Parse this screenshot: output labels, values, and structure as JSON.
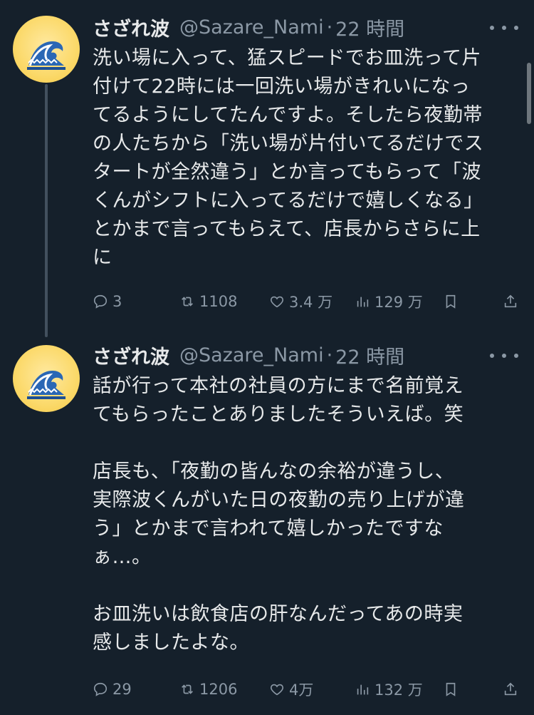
{
  "tweets": [
    {
      "author_name": "さざれ波",
      "handle": "@Sazare_Nami",
      "separator": "·",
      "time": "22 時間",
      "text": "洗い場に入って、猛スピードでお皿洗って片\n付けて22時には一回洗い場がきれいになっ\nてるようにしてたんですよ。そしたら夜勤帯\nの人たちから「洗い場が片付いてるだけでス\nタートが全然違う」とか言ってもらって「波\nくんがシフトに入ってるだけで嬉しくなる」\nとかまで言ってもらえて、店長からさらに上\nに",
      "replies": "3",
      "retweets": "1108",
      "likes": "3.4 万",
      "views": "129 万"
    },
    {
      "author_name": "さざれ波",
      "handle": "@Sazare_Nami",
      "separator": "·",
      "time": "22 時間",
      "text": "話が行って本社の社員の方にまで名前覚え\nてもらったことありましたそういえば。笑\n\n店長も、「夜勤の皆んなの余裕が違うし、\n実際波くんがいた日の夜勤の売り上げが違\nう」とかまで言われて嬉しかったですな\nぁ…。\n\nお皿洗いは飲食店の肝なんだってあの時実\n感しましたよな。",
      "replies": "29",
      "retweets": "1206",
      "likes": "4万",
      "views": "132 万"
    }
  ],
  "icons": {
    "avatar": "wave-emoji-avatar",
    "more": "more-dots-icon",
    "reply": "reply-bubble-icon",
    "retweet": "retweet-icon",
    "like": "heart-icon",
    "views": "views-bar-chart-icon",
    "bookmark": "bookmark-icon",
    "share": "share-upload-icon"
  },
  "colors": {
    "background": "#15202b",
    "text": "#e7e9ea",
    "secondary": "#8b98a5",
    "thread_line": "#42505e"
  }
}
